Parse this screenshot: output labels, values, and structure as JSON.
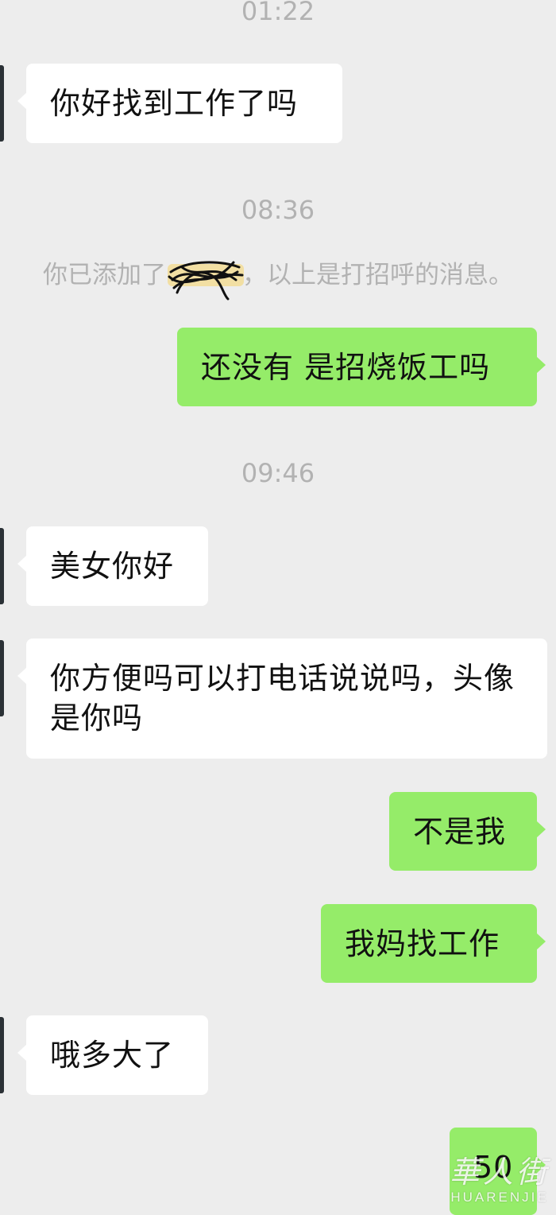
{
  "messages": [
    {
      "type": "timestamp",
      "text": "01:22"
    },
    {
      "type": "incoming",
      "text": "你好找到工作了吗"
    },
    {
      "type": "timestamp",
      "text": "08:36"
    },
    {
      "type": "system",
      "before": "你已添加了",
      "after": "，以上是打招呼的消息。"
    },
    {
      "type": "outgoing",
      "text": "还没有 是招烧饭工吗"
    },
    {
      "type": "timestamp",
      "text": "09:46"
    },
    {
      "type": "incoming",
      "text": "美女你好"
    },
    {
      "type": "incoming",
      "text": "你方便吗可以打电话说说吗，头像是你吗"
    },
    {
      "type": "outgoing",
      "text": "不是我"
    },
    {
      "type": "outgoing",
      "text": "我妈找工作"
    },
    {
      "type": "incoming",
      "text": "哦多大了"
    },
    {
      "type": "outgoing",
      "text": "50"
    }
  ],
  "watermark": {
    "chinese": "華人街",
    "latin": "HUARENJIE"
  },
  "colors": {
    "background": "#ededed",
    "outgoing_bubble": "#95ec69",
    "incoming_bubble": "#ffffff",
    "meta_text": "#b2b2b2"
  }
}
